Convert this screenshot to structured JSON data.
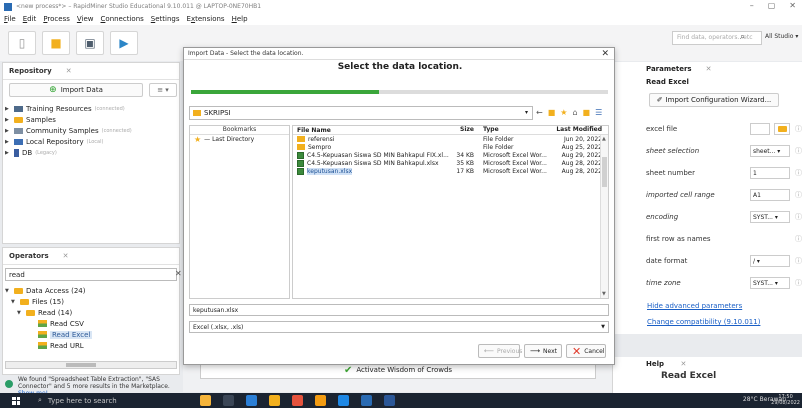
{
  "window": {
    "title": "<new process*> – RapidMiner Studio Educational 9.10.011 @ LAPTOP-0NE70HB1",
    "controls": [
      "–",
      "▢",
      "✕"
    ]
  },
  "menu": {
    "items": [
      "File",
      "Edit",
      "Process",
      "View",
      "Connections",
      "Settings",
      "Extensions",
      "Help"
    ],
    "mnemonics": [
      "F",
      "E",
      "P",
      "V",
      "C",
      "S",
      "x",
      "H"
    ]
  },
  "toolbar": {
    "search_placeholder": "Find data, operators...etc",
    "studio_label": "All Studio ▾"
  },
  "repository": {
    "title": "Repository",
    "import_label": "Import Data",
    "menu_label": "≡ ▾",
    "items": [
      {
        "label": "Training Resources",
        "note": "(connected)",
        "icon": "training"
      },
      {
        "label": "Samples",
        "note": "",
        "icon": "folder"
      },
      {
        "label": "Community Samples",
        "note": "(connected)",
        "icon": "people"
      },
      {
        "label": "Local Repository",
        "note": "(Local)",
        "icon": "blue"
      },
      {
        "label": "DB",
        "note": "(Legacy)",
        "icon": "db"
      }
    ]
  },
  "operators": {
    "title": "Operators",
    "search_value": "read",
    "items": [
      {
        "label": "Data Access (24)",
        "indent": 0,
        "icon": "folder",
        "arrow": "▼",
        "highlight": false
      },
      {
        "label": "Files (15)",
        "indent": 1,
        "icon": "folder",
        "arrow": "▼",
        "highlight": false
      },
      {
        "label": "Read (14)",
        "indent": 2,
        "icon": "folder",
        "arrow": "▼",
        "highlight": false
      },
      {
        "label": "Read CSV",
        "indent": 4,
        "icon": "read",
        "arrow": "",
        "highlight": false
      },
      {
        "label": "Read Excel",
        "indent": 4,
        "icon": "read",
        "arrow": "",
        "highlight": true
      },
      {
        "label": "Read URL",
        "indent": 4,
        "icon": "read",
        "arrow": "",
        "highlight": false
      }
    ]
  },
  "hint": {
    "text": "We found \"Spreadsheet Table Extraction\", \"SAS Connector\" and 5 more results in the Marketplace.",
    "link": "Show me!"
  },
  "center": {
    "activate_label": "Activate Wisdom of Crowds"
  },
  "parameters": {
    "title": "Parameters",
    "operator": "Read Excel",
    "wizard_label": "Import Configuration Wizard...",
    "rows": [
      {
        "label": "excel file",
        "value": "",
        "italic": false
      },
      {
        "label": "sheet selection",
        "value": "sheet... ▾",
        "italic": true
      },
      {
        "label": "sheet number",
        "value": "1",
        "italic": false
      },
      {
        "label": "imported cell range",
        "value": "A1",
        "italic": true
      },
      {
        "label": "encoding",
        "value": "SYST... ▾",
        "italic": true
      },
      {
        "label": "first row as names",
        "value": "",
        "italic": false
      },
      {
        "label": "date format",
        "value": "/ ▾",
        "italic": false
      },
      {
        "label": "time zone",
        "value": "SYST... ▾",
        "italic": true
      }
    ],
    "link_advanced": "Hide advanced parameters",
    "link_compat": "Change compatibility (9.10.011)"
  },
  "help": {
    "title": "Help",
    "heading": "Read Excel"
  },
  "dialog": {
    "title": "Import Data - Select the data location.",
    "heading": "Select the data location.",
    "progress": 0.45,
    "path": "SKRIPSI",
    "bookmarks_header": "Bookmarks",
    "bookmarks": [
      "— Last Directory"
    ],
    "columns": [
      "File Name",
      "Size",
      "Type",
      "Last Modified"
    ],
    "files": [
      {
        "name": "referensi",
        "size": "",
        "type": "File Folder",
        "modified": "Jun 20, 2022",
        "kind": "folder",
        "selected": false
      },
      {
        "name": "Sempro",
        "size": "",
        "type": "File Folder",
        "modified": "Aug 25, 2022",
        "kind": "folder",
        "selected": false
      },
      {
        "name": "C4.5-Kepuasan Siswa SD MIN Bahkapul FIX.xl...",
        "size": "34 KB",
        "type": "Microsoft Excel Wor...",
        "modified": "Aug 29, 2022",
        "kind": "xls",
        "selected": false
      },
      {
        "name": "C4.5-Kepuasan Siswa SD MIN Bahkapul.xlsx",
        "size": "35 KB",
        "type": "Microsoft Excel Wor...",
        "modified": "Aug 28, 2022",
        "kind": "xls",
        "selected": false
      },
      {
        "name": "keputusan.xlsx",
        "size": "17 KB",
        "type": "Microsoft Excel Wor...",
        "modified": "Aug 28, 2022",
        "kind": "xls",
        "selected": true
      }
    ],
    "filename": "keputusan.xlsx",
    "filetype": "Excel (.xlsx, .xls)",
    "btn_previous": "Previous",
    "btn_next": "Next",
    "btn_cancel": "Cancel"
  },
  "taskbar": {
    "search_placeholder": "Type here to search",
    "weather": "28°C  Berawan",
    "time": "17:50",
    "date": "29/08/2022"
  }
}
